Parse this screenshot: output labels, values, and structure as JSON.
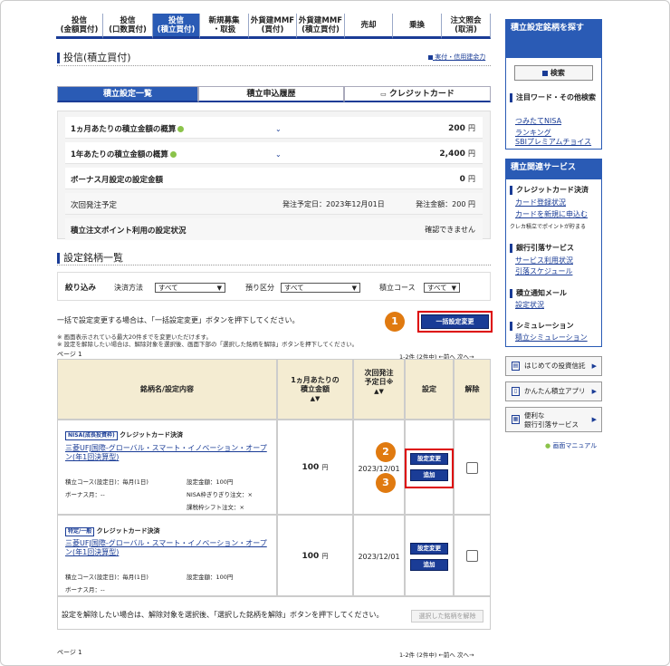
{
  "tabs": [
    {
      "line1": "投信",
      "line2": "(金額買付)"
    },
    {
      "line1": "投信",
      "line2": "(口数買付)"
    },
    {
      "line1": "投信",
      "line2": "(積立買付)"
    },
    {
      "line1": "新規募集",
      "line2": "・取扱"
    },
    {
      "line1": "外貨建MMF",
      "line2": "(買付)"
    },
    {
      "line1": "外貨建MMF",
      "line2": "(積立買付)"
    },
    {
      "line1": "売却",
      "line2": ""
    },
    {
      "line1": "乗換",
      "line2": ""
    },
    {
      "line1": "注文照会",
      "line2": "(取消)"
    }
  ],
  "page_title": "投信(積立買付)",
  "top_link": "実付・信用建余力",
  "subtabs": [
    "積立設定一覧",
    "積立申込履歴",
    "クレジットカード"
  ],
  "summary": {
    "r1_label": "1ヵ月あたりの積立金額の概算",
    "r1_value": "200",
    "r1_unit": "円",
    "r2_label": "1年あたりの積立金額の概算",
    "r2_value": "2,400",
    "r2_unit": "円",
    "r3_label": "ボーナス月設定の設定金額",
    "r3_value": "0",
    "r3_unit": "円",
    "r4_label": "次回発注予定",
    "r4_date": "発注予定日：2023年12月01日",
    "r4_amount": "発注金額：200",
    "r4_unit": "円",
    "r5_label": "積立注文ポイント利用の設定状況",
    "r5_value": "確認できません"
  },
  "section_title": "設定銘柄一覧",
  "filter": {
    "label": "絞り込み",
    "f1": "決済方法",
    "f1_val": "すべて",
    "f2": "預り区分",
    "f2_val": "すべて",
    "f3": "積立コース",
    "f3_val": "すべて"
  },
  "bulk_text": "一括で設定変更する場合は、「一括設定変更」ボタンを押下してください。",
  "bulk_btn": "一括設定変更",
  "note1": "※ 画面表示されている最大20件までを変更いただけます。",
  "note2": "※ 設定を解除したい場合は、解除対象を選択後、画面下部の「選択した銘柄を解除」ボタンを押下してください。",
  "page_label": "ページ 1",
  "pager": "1-2件 (2件中) ←前へ 次へ→",
  "table_head": {
    "name": "銘柄名/設定内容",
    "amount": "1ヵ月あたりの積立金額",
    "date": "次回発注予定日※",
    "setting": "設定",
    "cancel": "解除"
  },
  "rows": [
    {
      "tag": "NISA(成長投資枠)",
      "pay": "クレジットカード決済",
      "fund": "三菱UFJ国際-グローバル・スマート・イノベーション・オープン(年1回決算型)",
      "course": "積立コース(設定日)：毎月(1日)",
      "setamt": "設定金額：100円",
      "bonus": "ボーナス月：--",
      "nisa": "NISA枠ぎりぎり注文：×",
      "tax": "課税枠シフト注文：×",
      "amount": "100",
      "unit": "円",
      "date": "2023/12/01",
      "btn1": "設定変更",
      "btn2": "追加"
    },
    {
      "tag": "特定/一般",
      "pay": "クレジットカード決済",
      "fund": "三菱UFJ国際-グローバル・スマート・イノベーション・オープン(年1回決算型)",
      "course": "積立コース(設定日)：毎月(1日)",
      "setamt": "設定金額：100円",
      "bonus": "ボーナス月：--",
      "amount": "100",
      "unit": "円",
      "date": "2023/12/01",
      "btn1": "設定変更",
      "btn2": "追加"
    }
  ],
  "release_text": "設定を解除したい場合は、解除対象を選択後、「選択した銘柄を解除」ボタンを押下してください。",
  "release_btn": "選択した銘柄を解除",
  "badges": [
    "1",
    "2",
    "3"
  ],
  "sidebar": {
    "search_title": "積立設定銘柄を探す",
    "search_btn": "検索",
    "kw_title": "注目ワード・その他検索",
    "kw_links": [
      "つみたてNISA",
      "ランキング",
      "SBIプレミアムチョイス"
    ],
    "svc_title": "積立関連サービス",
    "cc_title": "クレジットカード決済",
    "cc_links": [
      "カード登録状況",
      "カードを新規に申込む"
    ],
    "cc_note": "クレカ積立でポイントが貯まる",
    "bank_title": "銀行引落サービス",
    "bank_links": [
      "サービス利用状況",
      "引落スケジュール"
    ],
    "mail_title": "積立通知メール",
    "mail_links": [
      "設定状況"
    ],
    "sim_title": "シミュレーション",
    "sim_links": [
      "積立シミュレーション"
    ],
    "b1": "はじめての投資信託",
    "b2": "かんたん積立アプリ",
    "b3a": "便利な",
    "b3b": "銀行引落サービス",
    "manual": "画面マニュアル"
  }
}
